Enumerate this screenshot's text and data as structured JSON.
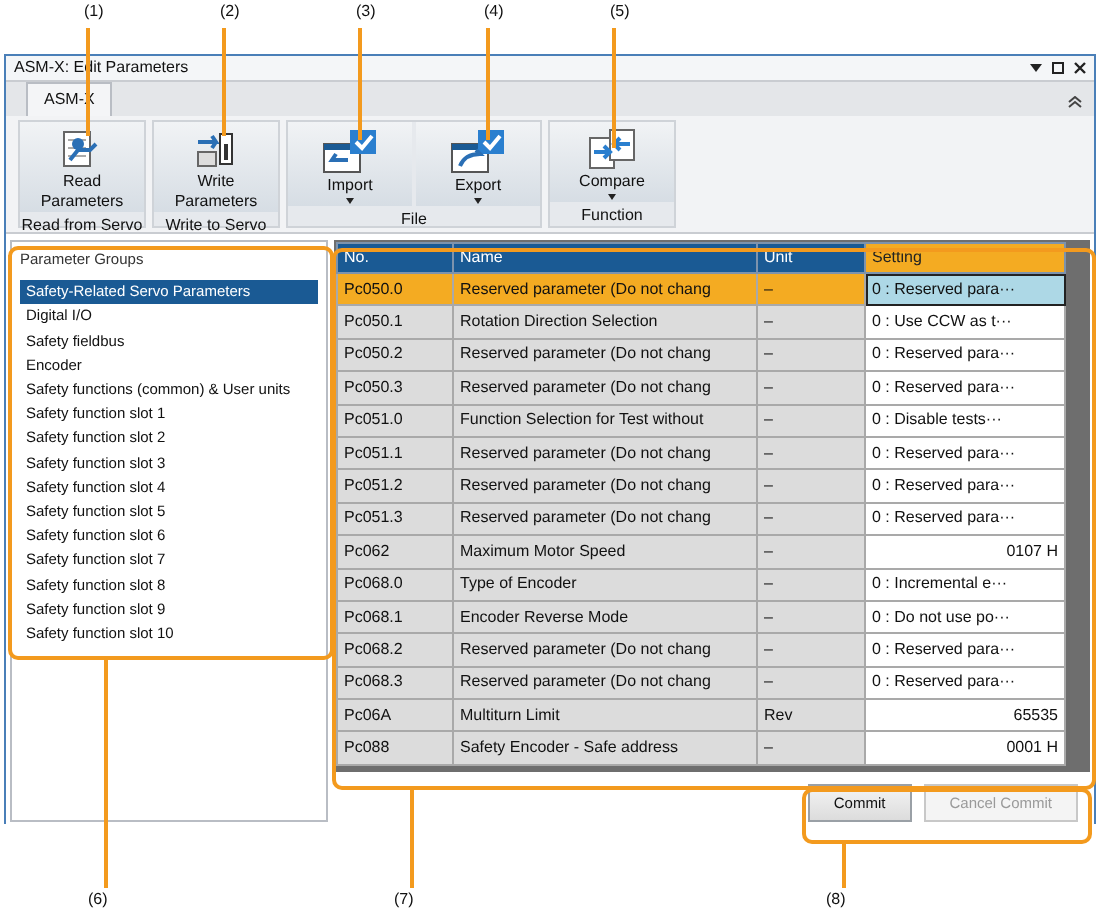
{
  "callouts": [
    {
      "label": "(1)"
    },
    {
      "label": "(2)"
    },
    {
      "label": "(3)"
    },
    {
      "label": "(4)"
    },
    {
      "label": "(5)"
    },
    {
      "label": "(6)"
    },
    {
      "label": "(7)"
    },
    {
      "label": "(8)"
    }
  ],
  "window": {
    "title": "ASM-X: Edit Parameters"
  },
  "tabs": [
    {
      "label": "ASM-X",
      "selected": true
    }
  ],
  "ribbon_groups": [
    {
      "label": "Read from Servo",
      "buttons": [
        {
          "label": "Read Parameters",
          "kind": "read",
          "dropdown": false
        }
      ]
    },
    {
      "label": "Write to Servo",
      "buttons": [
        {
          "label": "Write Parameters",
          "kind": "write",
          "dropdown": false
        }
      ]
    },
    {
      "label": "File",
      "buttons": [
        {
          "label": "Import",
          "kind": "import",
          "dropdown": true
        },
        {
          "label": "Export",
          "kind": "export",
          "dropdown": true
        }
      ]
    },
    {
      "label": "Function",
      "buttons": [
        {
          "label": "Compare",
          "kind": "compare",
          "dropdown": true
        }
      ]
    }
  ],
  "parameter_groups": {
    "title": "Parameter Groups",
    "items": [
      {
        "label": "Safety-Related Servo Parameters",
        "selected": true
      },
      {
        "label": "Digital I/O",
        "selected": false
      },
      {
        "label": "Safety fieldbus",
        "selected": false
      },
      {
        "label": "Encoder",
        "selected": false
      },
      {
        "label": "Safety functions (common) & User units",
        "selected": false
      },
      {
        "label": "Safety function slot 1",
        "selected": false
      },
      {
        "label": "Safety function slot 2",
        "selected": false
      },
      {
        "label": "Safety function slot 3",
        "selected": false
      },
      {
        "label": "Safety function slot 4",
        "selected": false
      },
      {
        "label": "Safety function slot 5",
        "selected": false
      },
      {
        "label": "Safety function slot 6",
        "selected": false
      },
      {
        "label": "Safety function slot 7",
        "selected": false
      },
      {
        "label": "Safety function slot 8",
        "selected": false
      },
      {
        "label": "Safety function slot 9",
        "selected": false
      },
      {
        "label": "Safety function slot 10",
        "selected": false
      }
    ]
  },
  "table": {
    "columns": [
      {
        "label": "No.",
        "selected": false
      },
      {
        "label": "Name",
        "selected": false
      },
      {
        "label": "Unit",
        "selected": false
      },
      {
        "label": "Setting",
        "selected": true
      }
    ],
    "rows": [
      {
        "no": "Pc050.0",
        "name": "Reserved parameter (Do not chang",
        "unit": "–",
        "setting": "0 : Reserved para···",
        "kind": "option",
        "selected": true
      },
      {
        "no": "Pc050.1",
        "name": "Rotation Direction Selection",
        "unit": "–",
        "setting": "0 : Use CCW as t···",
        "kind": "option",
        "selected": false
      },
      {
        "no": "Pc050.2",
        "name": "Reserved parameter (Do not chang",
        "unit": "–",
        "setting": "0 : Reserved para···",
        "kind": "option",
        "selected": false
      },
      {
        "no": "Pc050.3",
        "name": "Reserved parameter (Do not chang",
        "unit": "–",
        "setting": "0 : Reserved para···",
        "kind": "option",
        "selected": false
      },
      {
        "no": "Pc051.0",
        "name": "Function Selection for Test without",
        "unit": "–",
        "setting": "0 : Disable tests···",
        "kind": "option",
        "selected": false
      },
      {
        "no": "Pc051.1",
        "name": "Reserved parameter (Do not chang",
        "unit": "–",
        "setting": "0 : Reserved para···",
        "kind": "option",
        "selected": false
      },
      {
        "no": "Pc051.2",
        "name": "Reserved parameter (Do not chang",
        "unit": "–",
        "setting": "0 : Reserved para···",
        "kind": "option",
        "selected": false
      },
      {
        "no": "Pc051.3",
        "name": "Reserved parameter (Do not chang",
        "unit": "–",
        "setting": "0 : Reserved para···",
        "kind": "option",
        "selected": false
      },
      {
        "no": "Pc062",
        "name": "Maximum Motor Speed",
        "unit": "–",
        "setting": "0107 H",
        "kind": "value",
        "selected": false
      },
      {
        "no": "Pc068.0",
        "name": "Type of Encoder",
        "unit": "–",
        "setting": "0 : Incremental e···",
        "kind": "option",
        "selected": false
      },
      {
        "no": "Pc068.1",
        "name": "Encoder Reverse Mode",
        "unit": "–",
        "setting": "0 : Do not use po···",
        "kind": "option",
        "selected": false
      },
      {
        "no": "Pc068.2",
        "name": "Reserved parameter (Do not chang",
        "unit": "–",
        "setting": "0 : Reserved para···",
        "kind": "option",
        "selected": false
      },
      {
        "no": "Pc068.3",
        "name": "Reserved parameter (Do not chang",
        "unit": "–",
        "setting": "0 : Reserved para···",
        "kind": "option",
        "selected": false
      },
      {
        "no": "Pc06A",
        "name": "Multiturn Limit",
        "unit": "Rev",
        "setting": "65535",
        "kind": "value",
        "selected": false
      },
      {
        "no": "Pc088",
        "name": "Safety Encoder - Safe address",
        "unit": "–",
        "setting": "0001 H",
        "kind": "value",
        "selected": false
      }
    ]
  },
  "buttons": [
    {
      "label": "Commit",
      "disabled": false
    },
    {
      "label": "Cancel Commit",
      "disabled": true
    }
  ]
}
